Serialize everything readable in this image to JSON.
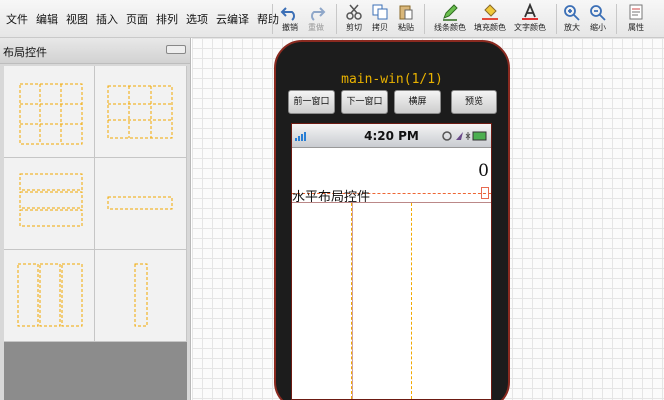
{
  "menu": [
    "文件",
    "编辑",
    "视图",
    "插入",
    "页面",
    "排列",
    "选项",
    "云编译",
    "帮助"
  ],
  "toolbar": {
    "undo": "撤销",
    "redo": "重做",
    "cut": "剪切",
    "copy": "拷贝",
    "paste": "粘贴",
    "line_color": "线条颜色",
    "fill_color": "填充颜色",
    "text_color": "文字颜色",
    "zoom_in": "放大",
    "zoom_out": "缩小",
    "properties": "属性"
  },
  "panel": {
    "title": "布局控件"
  },
  "phone": {
    "window_title": "main-win(1/1)",
    "buttons": [
      "前一窗口",
      "下一窗口",
      "横屏",
      "预览"
    ],
    "status_time": "4:20 PM",
    "display_value": "0",
    "layout_label": "水平布局控件"
  },
  "colors": {
    "accent_orange": "#f2a800",
    "phone_border": "#8a2a20",
    "title_text": "#e9b200"
  }
}
